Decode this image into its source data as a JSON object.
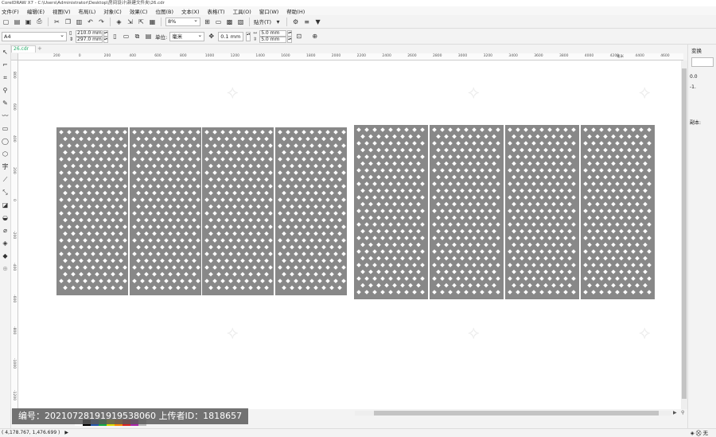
{
  "window": {
    "title": "CorelDRAW X7 - C:\\Users\\Administrator\\Desktop\\房间设计\\新建文件夹\\26.cdr"
  },
  "menu": [
    "文件(F)",
    "编辑(E)",
    "视图(V)",
    "布局(L)",
    "对象(C)",
    "效果(C)",
    "位图(B)",
    "文本(X)",
    "表格(T)",
    "工具(O)",
    "窗口(W)",
    "帮助(H)"
  ],
  "toolbar": {
    "zoom_value": "8%",
    "snap_label": "贴齐(T)"
  },
  "propbar": {
    "paper_size": "A4",
    "width": "210.0 mm",
    "height": "297.0 mm",
    "units_label": "单位:",
    "units_value": "毫米",
    "nudge": "0.1 mm",
    "dup_x": "5.0 mm",
    "dup_y": "5.0 mm"
  },
  "document": {
    "tab_name": "26.cdr"
  },
  "rulers": {
    "h_ticks": [
      "200",
      "0",
      "200",
      "400",
      "600",
      "800",
      "1000",
      "1200",
      "1400",
      "1600",
      "1800",
      "2000",
      "2200",
      "2400",
      "2600",
      "2800",
      "3000",
      "3200",
      "3400",
      "3600",
      "3800",
      "4000",
      "4200",
      "4400",
      "4600"
    ],
    "h_unit": "毫米",
    "v_ticks": [
      "800",
      "600",
      "400",
      "200",
      "0",
      "-200",
      "-400",
      "-600",
      "-800",
      "-1000",
      "-1200"
    ]
  },
  "canvas": {
    "panel_color": "#888888",
    "left_group_panels": 4,
    "right_group_panels": 4
  },
  "right_dock": {
    "title": "变换",
    "copies_label": "副本:",
    "val1": "0.0",
    "val2": "-1."
  },
  "status": {
    "coords": "( 4,178.767, 1,476.699 )",
    "fill": "无"
  },
  "watermark": {
    "text": "编号：20210728191919538060 上传者ID：1818657"
  },
  "palette_colors": [
    "#ffffff",
    "#000000",
    "#2255aa",
    "#11aa44",
    "#dddd00",
    "#ff8800",
    "#dd2222",
    "#aa22aa",
    "#bbbbbb"
  ]
}
